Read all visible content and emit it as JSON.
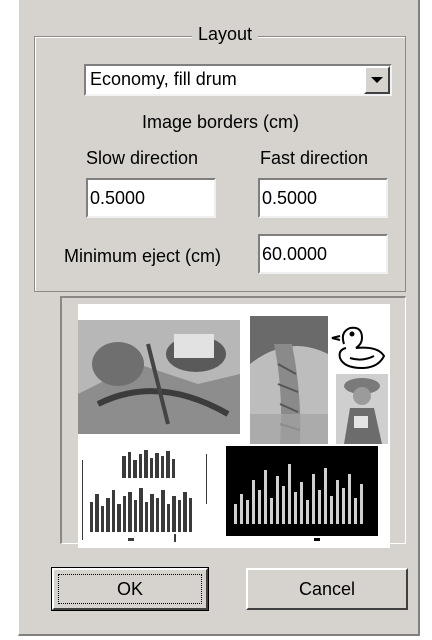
{
  "layout_group": {
    "title": "Layout"
  },
  "layout_select": {
    "value": "Economy, fill drum",
    "icon": "dropdown-arrow-icon"
  },
  "image_borders": {
    "heading": "Image borders (cm)",
    "slow_label": "Slow direction",
    "fast_label": "Fast direction",
    "slow_value": "0.5000",
    "fast_value": "0.5000"
  },
  "minimum_eject": {
    "label": "Minimum eject (cm)",
    "value": "60.0000"
  },
  "buttons": {
    "ok": "OK",
    "cancel": "Cancel"
  },
  "colors": {
    "dialog_bg": "#d6d3ce",
    "preview_dark": "#000000"
  }
}
